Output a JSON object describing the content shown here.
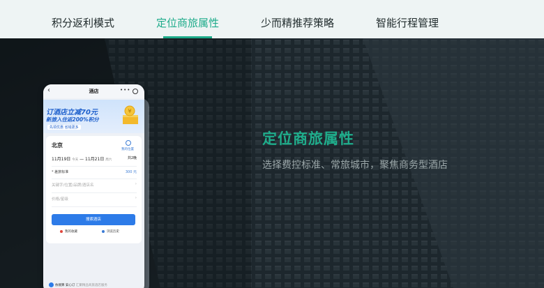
{
  "tabs": [
    {
      "label": "积分返利模式",
      "active": false
    },
    {
      "label": "定位商旅属性",
      "active": true
    },
    {
      "label": "少而精推荐策略",
      "active": false
    },
    {
      "label": "智能行程管理",
      "active": false
    }
  ],
  "hero": {
    "title": "定位商旅属性",
    "subtitle": "选择费控标准、常旅城市，聚焦商务型酒店"
  },
  "phone": {
    "header_title": "酒店",
    "banner": {
      "line1": "订酒店立减70元",
      "line2": "新旅入住返200%积分",
      "line3": "先领优惠  省钱更多"
    },
    "city": "北京",
    "location_label": "我的位置",
    "date_in": "11月19日",
    "date_in_sub": "今天",
    "date_sep": "—",
    "date_out": "11月21日",
    "date_out_sub": "周六",
    "nights": "共2晚",
    "standard_label": "* 差旅标准",
    "standard_value": "300 元",
    "keyword_placeholder": "关键字/位置/品牌/酒店名",
    "price_placeholder": "价格/星级",
    "search_button": "搜索酒店",
    "link_favorites": "我的收藏",
    "link_history": "浏览历史",
    "footer_brand": "依顺算 安心订",
    "footer_note": "汇聚精品商旅酒店服务"
  },
  "colors": {
    "accent": "#1dab8a",
    "tabbar_bg": "#eef4f4",
    "phone_button": "#2d7be8"
  }
}
